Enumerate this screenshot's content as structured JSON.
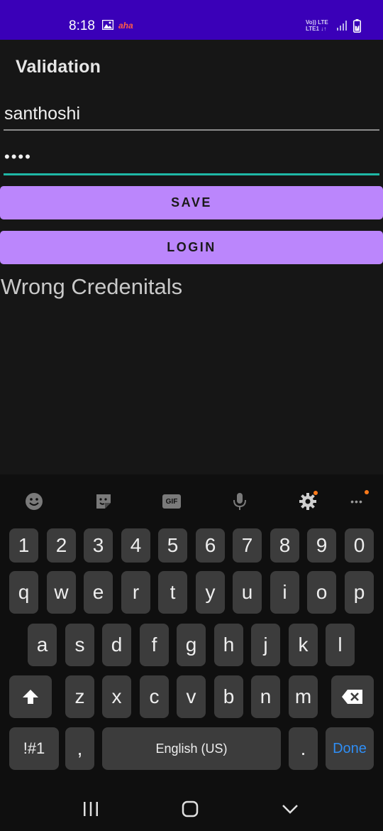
{
  "status_bar": {
    "time": "8:18",
    "icons": [
      "gallery-icon",
      "aha-logo",
      "volte-lte-icon",
      "signal-icon",
      "battery-icon"
    ],
    "aha_text": "aha",
    "network_line1": "Vo)) LTE",
    "network_line2": "LTE1 ↓↑"
  },
  "app": {
    "title": "Validation",
    "username_value": "santhoshi",
    "password_value": "••••",
    "save_label": "SAVE",
    "login_label": "LOGIN",
    "message": "Wrong Credenitals",
    "accent_color": "#bb86fc",
    "focus_color": "#1fb7a5"
  },
  "keyboard": {
    "toolbar": [
      "emoji-icon",
      "sticker-icon",
      "gif-icon",
      "mic-icon",
      "settings-icon",
      "more-icon"
    ],
    "gif_label": "GIF",
    "more_label": "•••",
    "row_numbers": [
      "1",
      "2",
      "3",
      "4",
      "5",
      "6",
      "7",
      "8",
      "9",
      "0"
    ],
    "row1": [
      "q",
      "w",
      "e",
      "r",
      "t",
      "y",
      "u",
      "i",
      "o",
      "p"
    ],
    "row2": [
      "a",
      "s",
      "d",
      "f",
      "g",
      "h",
      "j",
      "k",
      "l"
    ],
    "row3": [
      "z",
      "x",
      "c",
      "v",
      "b",
      "n",
      "m"
    ],
    "symbols_label": "!#1",
    "comma_label": ",",
    "space_label": "English (US)",
    "period_label": ".",
    "done_label": "Done"
  },
  "nav_bar": [
    "recents-icon",
    "home-icon",
    "back-icon"
  ]
}
